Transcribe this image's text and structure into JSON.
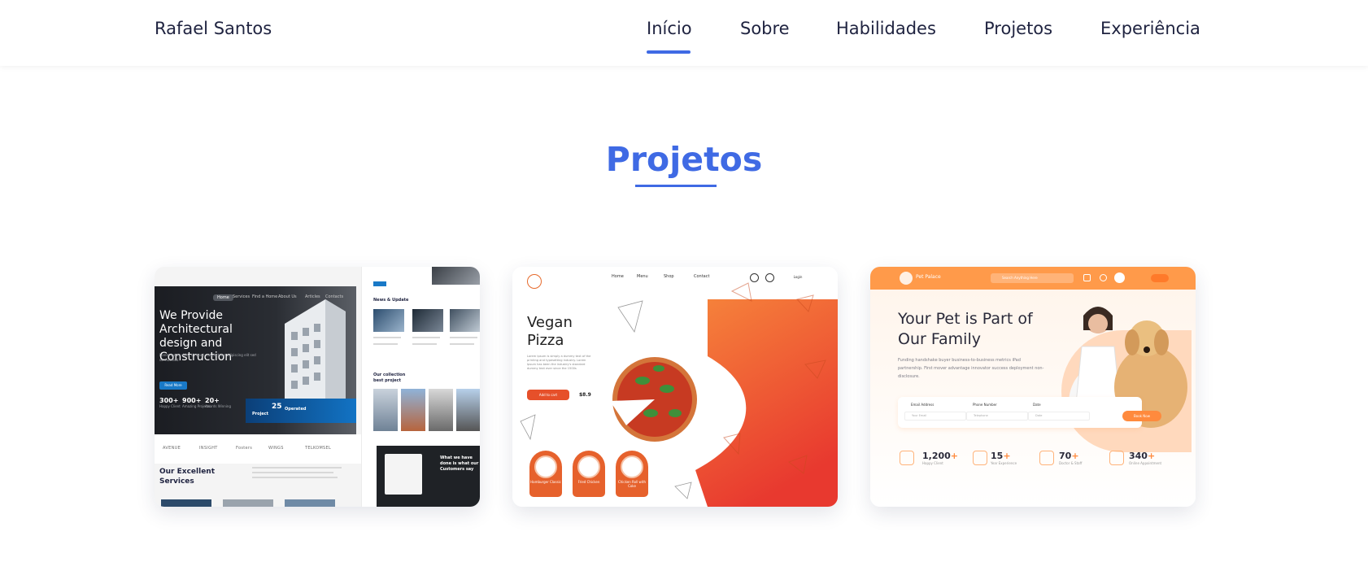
{
  "header": {
    "brand": "Rafael Santos",
    "nav": [
      {
        "label": "Início",
        "active": true
      },
      {
        "label": "Sobre"
      },
      {
        "label": "Habilidades"
      },
      {
        "label": "Projetos"
      },
      {
        "label": "Experiência"
      }
    ]
  },
  "section": {
    "title": "Projetos"
  },
  "colors": {
    "accent": "#3f6ae4",
    "pizza_orange": "#e6502a",
    "pet_orange": "#ff9a4a"
  },
  "projects": [
    {
      "name": "architecture-site",
      "menu": [
        "Home",
        "Services",
        "Find a Home",
        "About Us",
        "Articles",
        "Contacts"
      ],
      "headline": "We Provide Architectural design and Construction",
      "button": "Read More",
      "stats": [
        {
          "value": "300+",
          "label": "Happy Client"
        },
        {
          "value": "900+",
          "label": "Amazing Projects"
        },
        {
          "value": "20+",
          "label": "Awards Winning"
        }
      ],
      "banner_value": "25",
      "banner_label": "Project",
      "banner_extra": "Operated",
      "logos": [
        "AVENUE",
        "INSIGHT",
        "Fosters",
        "WINGS",
        "TELKOMSEL"
      ],
      "services_title": "Our Excellent Services",
      "news_title": "News & Update",
      "collection_title": "Our collection best project",
      "customers_title": "What we have done is what our Customers say"
    },
    {
      "name": "vegan-pizza-site",
      "nav": [
        "Home",
        "Menu",
        "Shop",
        "Contact"
      ],
      "login": "Login",
      "title": "Vegan Pizza",
      "description": "Lorem Ipsum is simply a dummy text of the printing and typesetting industry. Lorem Ipsum has been the industry's standard dummy text ever since the 1500s",
      "button": "Add to cart",
      "price": "$8.9",
      "items": [
        "Hamburger Classic",
        "Fried Chicken",
        "Chicken Roll with Coke"
      ]
    },
    {
      "name": "pet-palace-site",
      "brand": "Pet Palace",
      "search_placeholder": "Search Anything Here",
      "headline": "Your Pet is Part of Our Family",
      "description": "Funding handshake buyer business-to-business metrics iPad partnership. First mover advantage innovator success deployment non-disclosure.",
      "form": [
        {
          "label": "Email Address",
          "placeholder": "Your Email"
        },
        {
          "label": "Phone Number",
          "placeholder": "Telephone"
        },
        {
          "label": "Date",
          "placeholder": "Date"
        }
      ],
      "button": "Book Now",
      "stats": [
        {
          "value": "1,200",
          "label": "Happy Client"
        },
        {
          "value": "15",
          "label": "Year Experience"
        },
        {
          "value": "70",
          "label": "Doctor & Staff"
        },
        {
          "value": "340",
          "label": "Online Appointment"
        }
      ]
    }
  ]
}
